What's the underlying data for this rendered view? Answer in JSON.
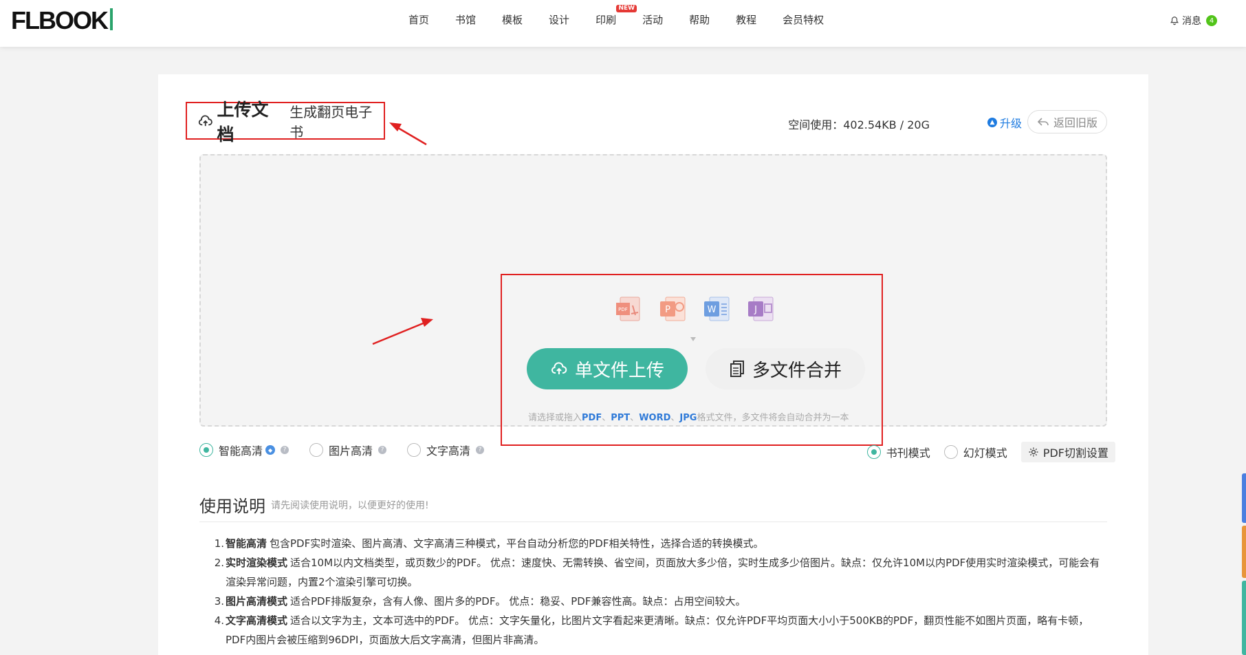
{
  "header": {
    "logo_text": "FLBOOK",
    "nav": [
      {
        "label": "首页"
      },
      {
        "label": "书馆"
      },
      {
        "label": "模板"
      },
      {
        "label": "设计"
      },
      {
        "label": "印刷",
        "badge": "NEW"
      },
      {
        "label": "活动"
      },
      {
        "label": "帮助"
      },
      {
        "label": "教程"
      },
      {
        "label": "会员特权"
      }
    ],
    "messages_label": "消息",
    "messages_count": "4"
  },
  "upload": {
    "title": "上传文档",
    "subtitle": "生成翻页电子书",
    "space_usage": "空间使用：402.54KB / 20G",
    "upgrade_label": "升级",
    "back_label": "返回旧版",
    "file_types": [
      "pdf-icon",
      "ppt-icon",
      "word-icon",
      "jpg-icon"
    ],
    "single_upload_label": "单文件上传",
    "multi_merge_label": "多文件合并",
    "hint_prefix": "请选择或拖入",
    "hint_formats": [
      "PDF",
      "PPT",
      "WORD",
      "JPG"
    ],
    "hint_suffix": "格式文件，多文件将会自动合并为一本"
  },
  "options": {
    "quality": [
      {
        "label": "智能高清",
        "selected": true
      },
      {
        "label": "图片高清",
        "selected": false
      },
      {
        "label": "文字高清",
        "selected": false
      }
    ],
    "mode": [
      {
        "label": "书刊模式",
        "selected": true
      },
      {
        "label": "幻灯模式",
        "selected": false
      }
    ],
    "pdf_setting_label": "PDF切割设置"
  },
  "usage": {
    "title": "使用说明",
    "subtitle": "请先阅读使用说明，以便更好的使用!",
    "items": [
      {
        "num": "1.",
        "term": "智能高清",
        "text": "包含PDF实时渲染、图片高清、文字高清三种模式，平台自动分析您的PDF相关特性，选择合适的转换模式。"
      },
      {
        "num": "2.",
        "term": "实时渲染模式",
        "text": "适合10M以内文档类型，或页数少的PDF。 优点：速度快、无需转换、省空间，页面放大多少倍，实时生成多少倍图片。缺点：仅允许10M以内PDF使用实时渲染模式，可能会有渲染异常问题，内置2个渲染引擎可切换。"
      },
      {
        "num": "3.",
        "term": "图片高清模式",
        "text": "适合PDF排版复杂，含有人像、图片多的PDF。 优点：稳妥、PDF兼容性高。缺点：占用空间较大。"
      },
      {
        "num": "4.",
        "term": "文字高清模式",
        "text": "适合以文字为主，文本可选中的PDF。 优点：文字矢量化，比图片文字看起来更清晰。缺点：仅允许PDF平均页面大小小于500KB的PDF，翻页性能不如图片页面，略有卡顿，PDF内图片会被压缩到96DPI，页面放大后文字高清，但图片非高清。"
      }
    ]
  },
  "colors": {
    "accent": "#3fb6a0",
    "annotation": "#e02020",
    "link": "#1e7be0"
  }
}
